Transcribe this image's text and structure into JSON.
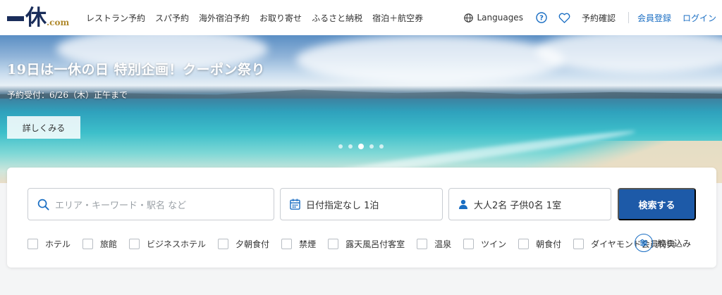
{
  "brand": {
    "logo_kanji": "休",
    "logo_suffix": ".com",
    "colors": {
      "navy": "#1a2d5a",
      "gold": "#b08a2e",
      "link": "#1a6ec3",
      "button": "#1d5aa8"
    }
  },
  "header": {
    "nav": [
      "レストラン予約",
      "スパ予約",
      "海外宿泊予約",
      "お取り寄せ",
      "ふるさと納税",
      "宿泊＋航空券"
    ],
    "languages": "Languages",
    "help_icon": "question-circle-icon",
    "favorite_icon": "heart-icon",
    "booking_check": "予約確認",
    "signup": "会員登録",
    "login": "ログイン"
  },
  "hero": {
    "title": "19日は一休の日 特別企画！クーポン祭り",
    "subtitle": "予約受付：6/26（木）正午まで",
    "button": "詳しくみる",
    "slides_total": 5,
    "slide_active": 3
  },
  "search": {
    "keyword_placeholder": "エリア・キーワード・駅名 など",
    "date_value": "日付指定なし 1泊",
    "guests_value": "大人2名 子供0名 1室",
    "submit": "検索する",
    "filters": [
      "ホテル",
      "旅館",
      "ビジネスホテル",
      "夕朝食付",
      "禁煙",
      "露天風呂付客室",
      "温泉",
      "ツイン",
      "朝食付",
      "ダイヤモンド会員特典"
    ],
    "narrow": "絞り込み"
  }
}
